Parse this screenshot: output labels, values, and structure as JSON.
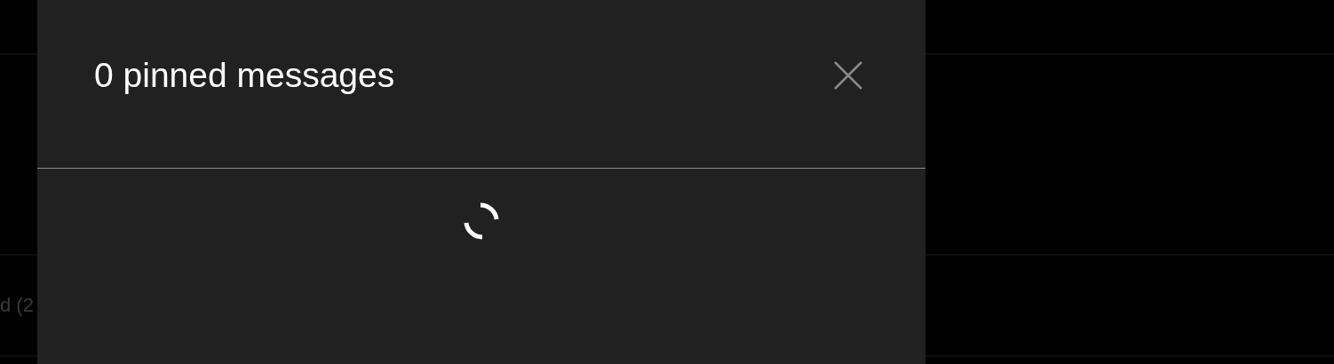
{
  "background": {
    "row_text": "d (2"
  },
  "dialog": {
    "title": "0 pinned messages",
    "loading": true
  }
}
